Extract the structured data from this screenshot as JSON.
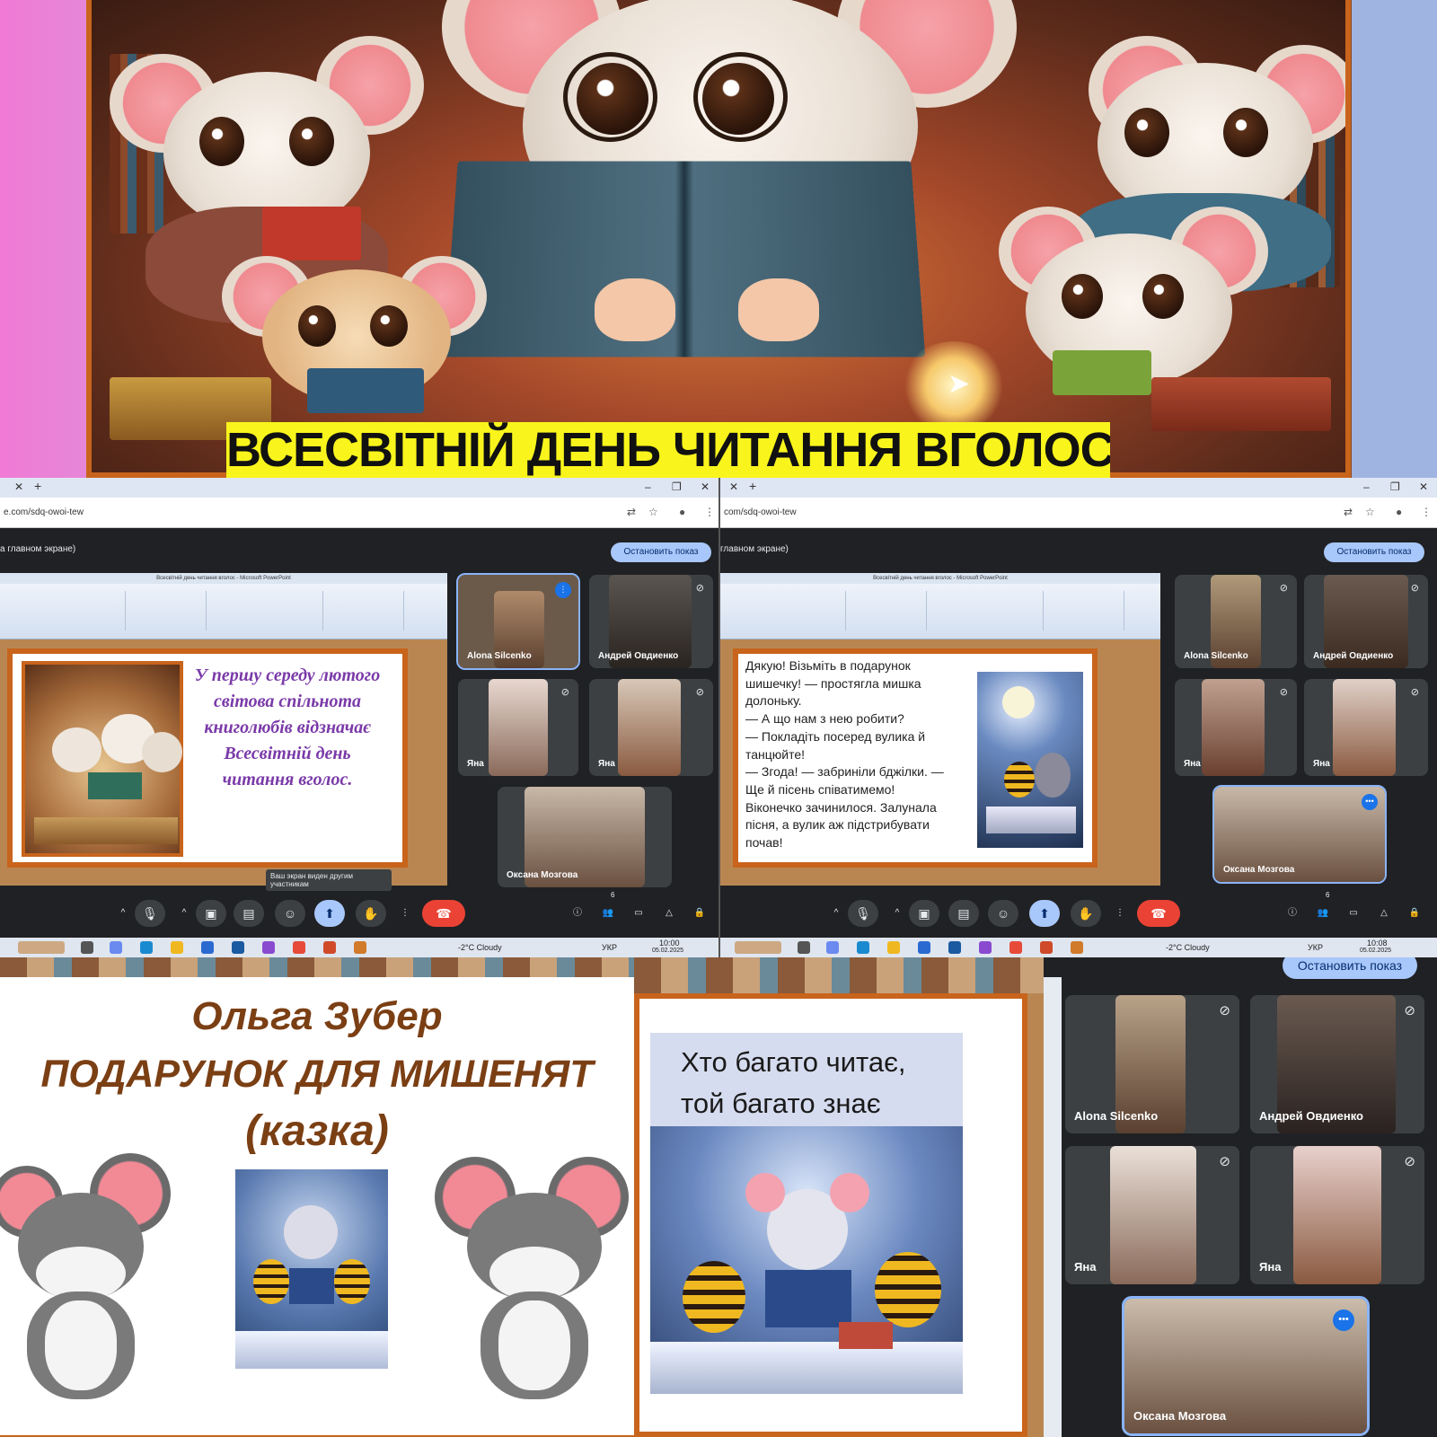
{
  "banner": {
    "caption": "ВСЕСВІТНІЙ ДЕНЬ ЧИТАННЯ ВГОЛОС"
  },
  "meet_left": {
    "url": "e.com/sdq-owoi-tew",
    "presenting_label": "а главном экране)",
    "stop_label": "Остановить показ",
    "ppt_title": "Всесвітній день читання вголос - Microsoft PowerPoint",
    "slide_text": "У першу середу лютого світова спільнота книголюбів відзначає Всесвітній день читання вголос.",
    "tooltip": "Ваш экран виден другим участникам",
    "participants_count": "6",
    "participants": [
      {
        "name": "Alona Silcenko"
      },
      {
        "name": "Андрей Овдиенко"
      },
      {
        "name": "Яна"
      },
      {
        "name": "Яна"
      },
      {
        "name": "Оксана Мозгова"
      }
    ],
    "taskbar": {
      "weather": "-2°C  Cloudy",
      "lang": "УКР",
      "time": "10:00",
      "date": "05.02.2025"
    }
  },
  "meet_right": {
    "url": "com/sdq-owoi-tew",
    "presenting_label": "главном экране)",
    "stop_label": "Остановить показ",
    "ppt_title": "Всесвітній день читання вголос - Microsoft PowerPoint",
    "slide_lines": [
      "Дякую! Візьміть в подарунок",
      "шишечку! — простягла мишка",
      "долоньку.",
      "— А що нам з нею робити?",
      "— Покладіть посеред вулика й",
      "танцюйте!",
      "— Згода! — забриніли бджілки. —",
      "Ще й пісень співатимемо!",
      "Віконечко зачинилося. Залунала",
      "пісня, а вулик аж підстрибувати",
      "почав!"
    ],
    "participants_count": "6",
    "participants": [
      {
        "name": "Alona Silcenko"
      },
      {
        "name": "Андрей Овдиенко"
      },
      {
        "name": "Яна"
      },
      {
        "name": "Яна"
      },
      {
        "name": "Оксана Мозгова"
      }
    ],
    "taskbar": {
      "weather": "-2°C  Cloudy",
      "lang": "УКР",
      "time": "10:08",
      "date": "05.02.2025"
    }
  },
  "bottom_left": {
    "author": "Ольга Зубер",
    "title": "ПОДАРУНОК ДЛЯ МИШЕНЯТ",
    "genre": "(казка)"
  },
  "bottom_right": {
    "proverb_line1": "Хто багато читає,",
    "proverb_line2": "той багато знає",
    "stop_label": "Остановить показ",
    "participants": [
      {
        "name": "Alona Silcenko"
      },
      {
        "name": "Андрей Овдиенко"
      },
      {
        "name": "Яна"
      },
      {
        "name": "Яна"
      },
      {
        "name": "Оксана Мозгова"
      }
    ]
  },
  "icons": {
    "mic_off": "mic-off-icon",
    "more": "more-dots-icon"
  },
  "colors": {
    "banner_caption_bg": "#f9f51c",
    "meet_bg": "#202124",
    "stop_button": "#a8c7fa",
    "end_call": "#ea4335",
    "slide_border": "#c8641c",
    "slide_purple": "#7a3aa8",
    "title_brown": "#7b3f14"
  }
}
